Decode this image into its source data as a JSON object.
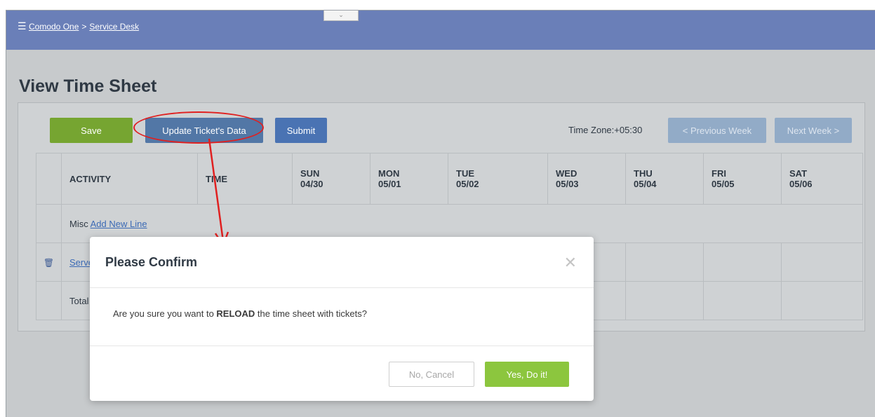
{
  "breadcrumb": {
    "root": "Comodo One",
    "separator": ">",
    "current": "Service Desk"
  },
  "page": {
    "title": "View Time Sheet"
  },
  "toolbar": {
    "save_label": "Save",
    "update_label": "Update Ticket's Data",
    "submit_label": "Submit",
    "timezone_text": "Time Zone:+05:30",
    "prev_week_label": "< Previous Week",
    "next_week_label": "Next Week >"
  },
  "table": {
    "headers": [
      {
        "top": "ACTIVITY",
        "bottom": ""
      },
      {
        "top": "TIME",
        "bottom": ""
      },
      {
        "top": "SUN",
        "bottom": "04/30"
      },
      {
        "top": "MON",
        "bottom": "05/01"
      },
      {
        "top": "TUE",
        "bottom": "05/02"
      },
      {
        "top": "WED",
        "bottom": "05/03"
      },
      {
        "top": "THU",
        "bottom": "05/04"
      },
      {
        "top": "FRI",
        "bottom": "05/05"
      },
      {
        "top": "SAT",
        "bottom": "05/06"
      }
    ],
    "misc_row": {
      "label": "Misc",
      "link": "Add New Line"
    },
    "service_row": {
      "link": "Serve"
    },
    "total_row": {
      "label": "Total"
    }
  },
  "modal": {
    "title": "Please Confirm",
    "close_glyph": "✕",
    "message_before": "Are you sure you want to ",
    "message_bold": "RELOAD",
    "message_after": " the time sheet with tickets?",
    "cancel_label": "No, Cancel",
    "confirm_label": "Yes, Do it!"
  },
  "colors": {
    "topbar": "#6a7fb8",
    "save_button": "#76a531",
    "update_button": "#5277a6",
    "confirm_button": "#8cc63e",
    "annotation": "#e02020"
  },
  "icons": {
    "menu": "hamburger-icon",
    "delete": "trash-icon",
    "collapse": "chevron-down-icon"
  }
}
